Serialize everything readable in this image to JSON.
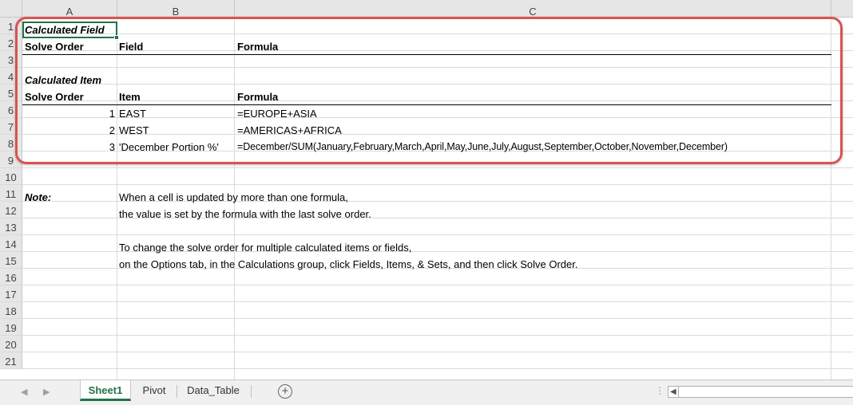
{
  "columns": [
    "A",
    "B",
    "C"
  ],
  "rows": [
    "1",
    "2",
    "3",
    "4",
    "5",
    "6",
    "7",
    "8",
    "9",
    "10",
    "11",
    "12",
    "13",
    "14",
    "15",
    "16",
    "17",
    "18",
    "19",
    "20",
    "21"
  ],
  "cells": {
    "a1": "Calculated Field",
    "a2": "Solve Order",
    "b2": "Field",
    "c2": "Formula",
    "a4": "Calculated Item",
    "a5": "Solve Order",
    "b5": "Item",
    "c5": "Formula",
    "a6": "1",
    "b6": "EAST",
    "c6": "=EUROPE+ASIA",
    "a7": "2",
    "b7": "WEST",
    "c7": "=AMERICAS+AFRICA",
    "a8": "3",
    "b8": "'December Portion %'",
    "c8": "=December/SUM(January,February,March,April,May,June,July,August,September,October,November,December)",
    "a11": "Note:",
    "b11": "When a cell is updated by more than one formula,",
    "b12": "the value is set by the formula with the last solve order.",
    "b14": "To change the solve order for multiple calculated items or fields,",
    "b15": "on the Options tab, in the Calculations group, click Fields, Items, & Sets, and then click Solve Order."
  },
  "tabs": [
    "Sheet1",
    "Pivot",
    "Data_Table"
  ],
  "active_tab": "Sheet1",
  "colors": {
    "accent": "#217346",
    "highlight_frame": "#d9534f"
  }
}
